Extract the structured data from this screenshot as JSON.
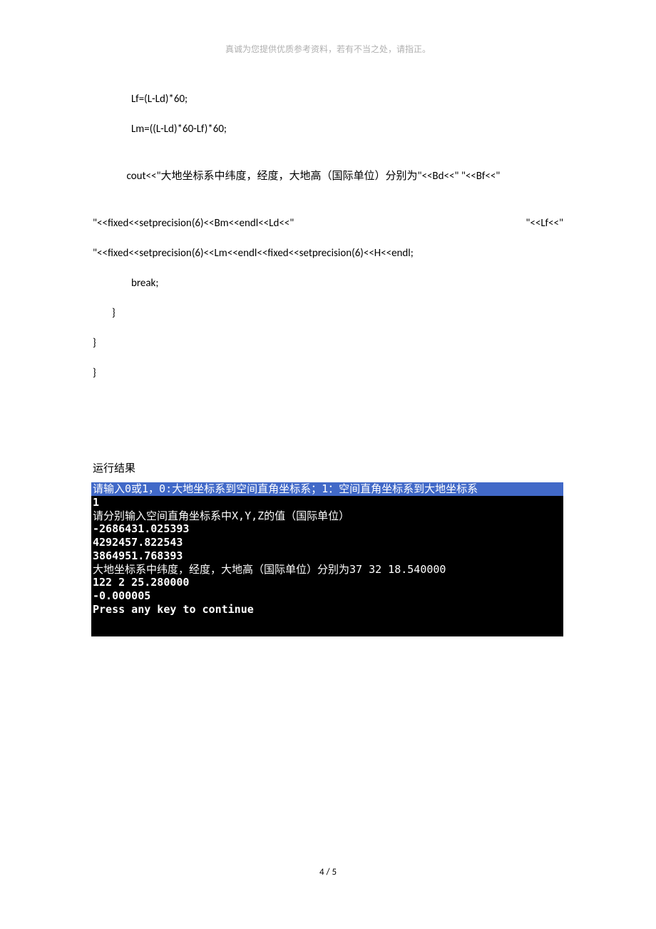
{
  "header": {
    "text": "真诚为您提供优质参考资料，若有不当之处，请指正。"
  },
  "code": {
    "line1": "Lf=(L-Ld)*60;",
    "line2": "Lm=((L-Ld)*60-Lf)*60;",
    "line3a": "        cout<<\"大地坐标系中纬度，经度，大地高（国际单位）分别为\"<<Bd<<\" \"<<Bf<<\"",
    "line3b": "\"<<fixed<<setprecision(6)<<Bm<<endl<<Ld<<\"",
    "line3b_end": "\"<<Lf<<\"",
    "line3c": "\"<<fixed<<setprecision(6)<<Lm<<endl<<fixed<<setprecision(6)<<H<<endl;",
    "line4": "break;",
    "line5": "}",
    "line6": "}",
    "line7": "}"
  },
  "section": {
    "title": "运行结果"
  },
  "console": {
    "line1": "请输入0或1，0:大地坐标系到空间直角坐标系；1：空间直角坐标系到大地坐标系",
    "line2": "1",
    "line3": "请分别输入空间直角坐标系中X,Y,Z的值（国际单位）",
    "line4": "-2686431.025393",
    "line5": "4292457.822543",
    "line6": "3864951.768393",
    "line7": "大地坐标系中纬度，经度，大地高（国际单位）分别为37 32 18.540000",
    "line8": "122 2 25.280000",
    "line9": "-0.000005",
    "line10": "Press any key to continue"
  },
  "footer": {
    "text": "4 / 5"
  }
}
